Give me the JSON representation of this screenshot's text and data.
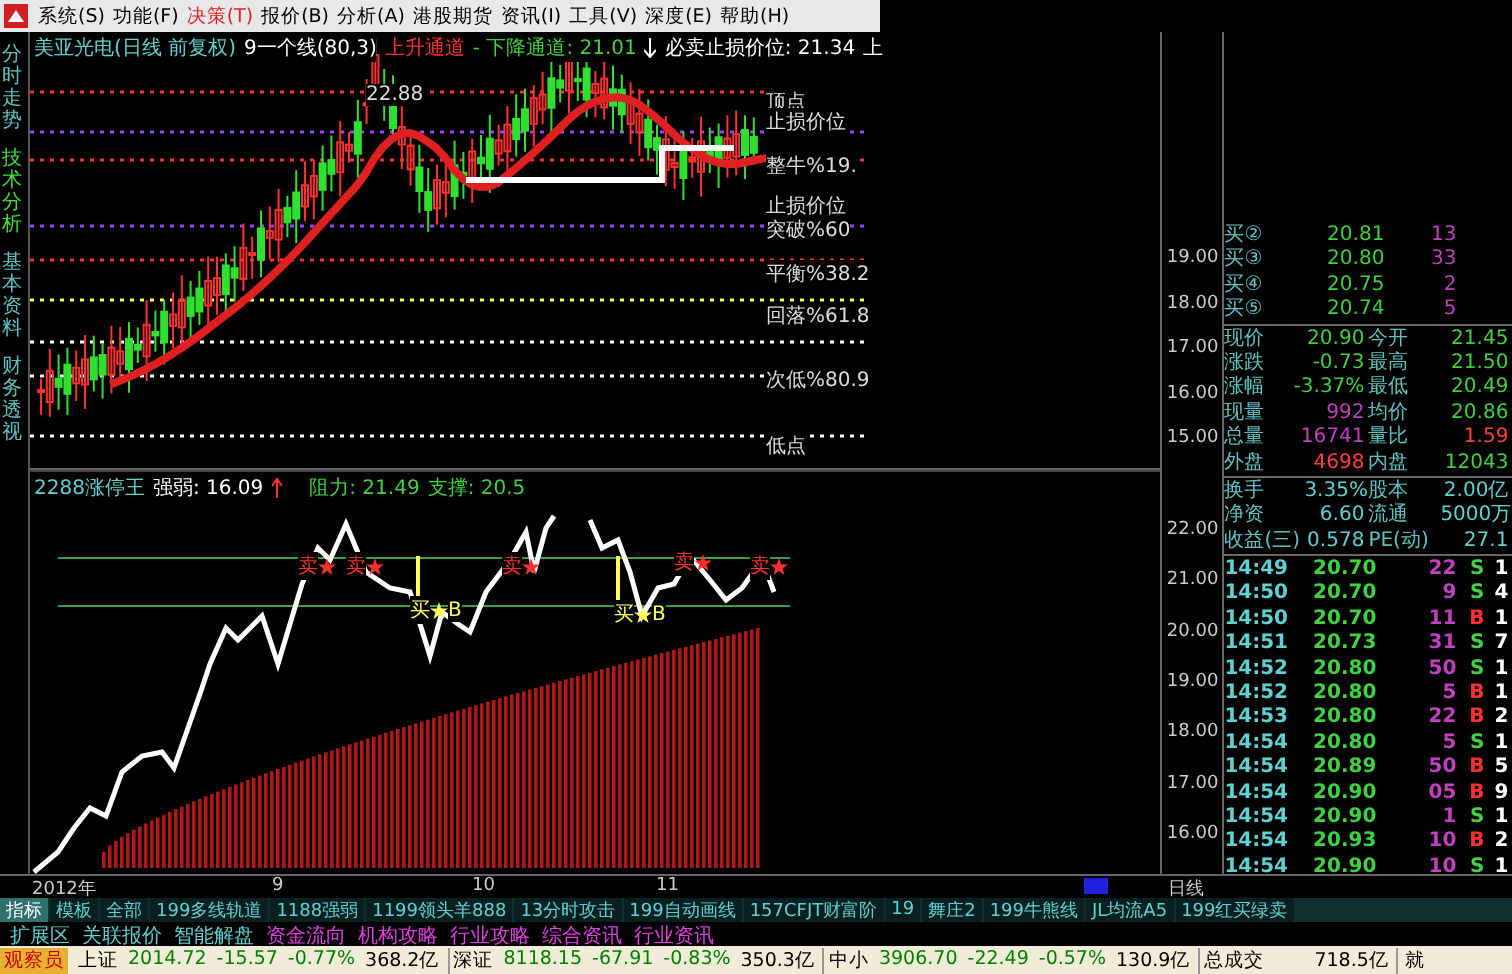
{
  "menu": {
    "items": [
      {
        "label": "系统(S)",
        "selected": false
      },
      {
        "label": "功能(F)",
        "selected": false
      },
      {
        "label": "决策(T)",
        "selected": true
      },
      {
        "label": "报价(B)",
        "selected": false
      },
      {
        "label": "分析(A)",
        "selected": false
      },
      {
        "label": "港股期货",
        "selected": false
      },
      {
        "label": "资讯(I)",
        "selected": false
      },
      {
        "label": "工具(V)",
        "selected": false
      },
      {
        "label": "深度(E)",
        "selected": false
      },
      {
        "label": "帮助(H)",
        "selected": false
      }
    ]
  },
  "side_tabs": [
    {
      "label": "分时走势",
      "selected": false
    },
    {
      "label": "技术分析",
      "selected": true
    },
    {
      "label": "基本资料",
      "selected": false
    },
    {
      "label": "财务透视",
      "selected": false
    }
  ],
  "chart_header": {
    "title": "美亚光电(日线 前复权)",
    "indicator": "9一个线(80,3)",
    "up_channel": "上升通道",
    "down_channel": "- 下降通道: 21.01",
    "stop_loss": "必卖止损价位: 21.34",
    "column_6": "上"
  },
  "chart_labels": [
    "22.88",
    "顶点",
    "止损价位",
    "整牛%19.",
    "止损价位",
    "突破%60",
    "平衡%38.2",
    "回落%61.8",
    "次低%80.9",
    "低点"
  ],
  "upper_axis": [
    "19.00",
    "18.00",
    "17.00",
    "16.00",
    "15.00"
  ],
  "indicator_header": {
    "name": "2288涨停王",
    "strength": "强弱: 16.09",
    "resistance": "阻力: 21.49",
    "support": "支撑: 20.5"
  },
  "signals": [
    {
      "kind": "sell",
      "text": "卖"
    },
    {
      "kind": "sell",
      "text": "卖"
    },
    {
      "kind": "buy",
      "text": "买",
      "tag": "B"
    },
    {
      "kind": "sell",
      "text": "卖"
    },
    {
      "kind": "buy",
      "text": "买",
      "tag": "B"
    },
    {
      "kind": "sell",
      "text": "卖"
    },
    {
      "kind": "sell",
      "text": "卖"
    }
  ],
  "lower_axis": [
    "22.00",
    "21.00",
    "20.00",
    "19.00",
    "18.00",
    "17.00",
    "16.00"
  ],
  "date_axis": {
    "labels": [
      "2012年",
      "9",
      "10",
      "11"
    ],
    "period": "日线"
  },
  "quote": {
    "bids": [
      {
        "label": "买②",
        "price": "20.81",
        "volume": "13"
      },
      {
        "label": "买③",
        "price": "20.80",
        "volume": "33"
      },
      {
        "label": "买④",
        "price": "20.75",
        "volume": "2"
      },
      {
        "label": "买⑤",
        "price": "20.74",
        "volume": "5"
      }
    ],
    "stats": [
      {
        "label": "现价",
        "value": "20.90",
        "color": "#40d040"
      },
      {
        "label": "今开",
        "value": "21.45",
        "color": "#40d040"
      },
      {
        "label": "涨跌",
        "value": "-0.73",
        "color": "#40d040"
      },
      {
        "label": "最高",
        "value": "21.50",
        "color": "#40d040"
      },
      {
        "label": "涨幅",
        "value": "-3.37%",
        "color": "#40d040"
      },
      {
        "label": "最低",
        "value": "20.49",
        "color": "#40d040"
      },
      {
        "label": "现量",
        "value": "992",
        "color": "#c040c0"
      },
      {
        "label": "均价",
        "value": "20.86",
        "color": "#40d040"
      },
      {
        "label": "总量",
        "value": "16741",
        "color": "#c040c0"
      },
      {
        "label": "量比",
        "value": "1.59",
        "color": "#ff4040"
      },
      {
        "label": "外盘",
        "value": "4698",
        "color": "#ff4040"
      },
      {
        "label": "内盘",
        "value": "12043",
        "color": "#40d040"
      }
    ],
    "info": [
      {
        "label": "换手",
        "value": "3.35%",
        "label_2": "股本",
        "value_2": "2.00亿"
      },
      {
        "label": "净资",
        "value": "6.60",
        "label_2": "流通",
        "value_2": "5000万"
      },
      {
        "label": "收益(三)",
        "value": "0.578",
        "label_2": "PE(动)",
        "value_2": "27.1"
      }
    ],
    "ticks": [
      {
        "time": "14:49",
        "price": "20.70",
        "volume": "22",
        "side": "S",
        "kind": "sell",
        "column_5": "1"
      },
      {
        "time": "14:50",
        "price": "20.70",
        "volume": "9",
        "side": "S",
        "kind": "sell",
        "column_5": "4"
      },
      {
        "time": "14:50",
        "price": "20.70",
        "volume": "11",
        "side": "B",
        "kind": "buy",
        "column_5": "1"
      },
      {
        "time": "14:51",
        "price": "20.73",
        "volume": "31",
        "side": "S",
        "kind": "sell",
        "column_5": "7"
      },
      {
        "time": "14:52",
        "price": "20.80",
        "volume": "50",
        "side": "S",
        "kind": "sell",
        "column_5": "1"
      },
      {
        "time": "14:52",
        "price": "20.80",
        "volume": "5",
        "side": "B",
        "kind": "buy",
        "column_5": "1"
      },
      {
        "time": "14:53",
        "price": "20.80",
        "volume": "22",
        "side": "B",
        "kind": "buy",
        "column_5": "2"
      },
      {
        "time": "14:54",
        "price": "20.80",
        "volume": "5",
        "side": "S",
        "kind": "sell",
        "column_5": "1"
      },
      {
        "time": "14:54",
        "price": "20.89",
        "volume": "50",
        "side": "B",
        "kind": "buy",
        "column_5": "5"
      },
      {
        "time": "14:54",
        "price": "20.90",
        "volume": "05",
        "side": "B",
        "kind": "buy",
        "column_5": "9"
      },
      {
        "time": "14:54",
        "price": "20.90",
        "volume": "1",
        "side": "S",
        "kind": "sell",
        "column_5": "1"
      },
      {
        "time": "14:54",
        "price": "20.93",
        "volume": "10",
        "side": "B",
        "kind": "buy",
        "column_5": "2"
      },
      {
        "time": "14:54",
        "price": "20.90",
        "volume": "10",
        "side": "S",
        "kind": "sell",
        "column_5": "1"
      }
    ]
  },
  "indicator_tabs": [
    {
      "label": "指标",
      "selected": true
    },
    {
      "label": "模板",
      "selected": false
    },
    {
      "label": "全部",
      "selected": false
    },
    {
      "label": "199多线轨道",
      "selected": false
    },
    {
      "label": "1188强弱",
      "selected": false
    },
    {
      "label": "1199领头羊888",
      "selected": false
    },
    {
      "label": "13分时攻击",
      "selected": false
    },
    {
      "label": "199自动画线",
      "selected": false
    },
    {
      "label": "157CFJT财富阶",
      "selected": false
    },
    {
      "label": "19",
      "selected": false
    },
    {
      "label": "舞庄2",
      "selected": false
    },
    {
      "label": "199牛熊线",
      "selected": false
    },
    {
      "label": "JL均流A5",
      "selected": false
    },
    {
      "label": "199红买绿卖",
      "selected": false
    }
  ],
  "extension_tabs": [
    {
      "label": "扩展区",
      "kind": "tool"
    },
    {
      "label": "关联报价",
      "kind": "tool"
    },
    {
      "label": "智能解盘",
      "kind": "tool"
    },
    {
      "label": "资金流向",
      "kind": "info"
    },
    {
      "label": "机构攻略",
      "kind": "info"
    },
    {
      "label": "行业攻略",
      "kind": "info"
    },
    {
      "label": "综合资讯",
      "kind": "info"
    },
    {
      "label": "行业资讯",
      "kind": "info"
    }
  ],
  "status_bar": {
    "badge": "观察员",
    "indices": [
      {
        "name": "上证",
        "value": "2014.72",
        "change": "-15.57",
        "percent": "-0.77%",
        "amount": "368.2亿"
      },
      {
        "name": "深证",
        "value": "8118.15",
        "change": "-67.91",
        "percent": "-0.83%",
        "amount": "350.3亿"
      },
      {
        "name": "中小",
        "value": "3906.70",
        "change": "-22.49",
        "percent": "-0.57%",
        "amount": "130.9亿"
      }
    ],
    "total_label": "总成交",
    "total": "718.5亿",
    "column_6": "就"
  }
}
